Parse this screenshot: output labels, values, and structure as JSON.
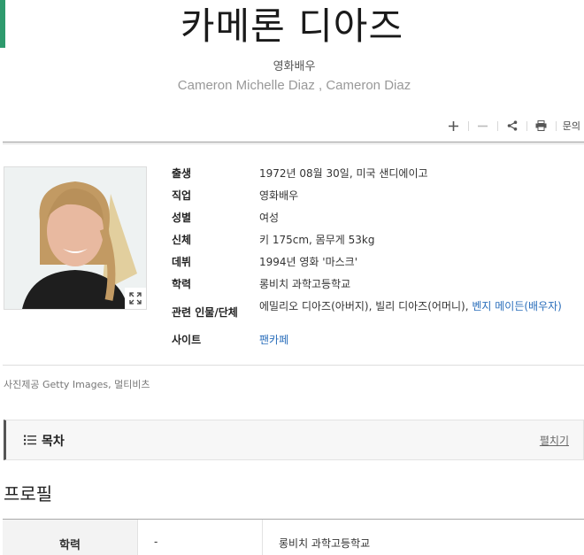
{
  "header": {
    "title": "카메론 디아즈",
    "subtitle": "영화배우",
    "alt_names": "Cameron Michelle Diaz , Cameron Diaz"
  },
  "toolbar": {
    "inquiry_label": "문의"
  },
  "profile_info": [
    {
      "label": "출생",
      "value": "1972년 08월 30일, 미국 샌디에이고"
    },
    {
      "label": "직업",
      "value": "영화배우"
    },
    {
      "label": "성별",
      "value": "여성"
    },
    {
      "label": "신체",
      "value": "키 175cm, 몸무게 53kg"
    },
    {
      "label": "데뷔",
      "value": "1994년 영화 '마스크'"
    },
    {
      "label": "학력",
      "value": "롱비치 과학고등학교"
    },
    {
      "label": "관련 인물/단체",
      "value": "에밀리오 디아즈(아버지), 빌리 디아즈(어머니), ",
      "link": "벤지 메이든(배우자)"
    },
    {
      "label": "사이트",
      "link": "팬카페"
    }
  ],
  "photo_credit": "사진제공  Getty Images, 멀티비츠",
  "toc": {
    "title": "목차",
    "expand_label": "펼치기"
  },
  "section": {
    "title": "프로필"
  },
  "education_table": {
    "header": "학력",
    "period": "-",
    "school": "롱비치 과학고등학교"
  },
  "colors": {
    "accent": "#2e9a6d",
    "link": "#2a6ebb"
  }
}
